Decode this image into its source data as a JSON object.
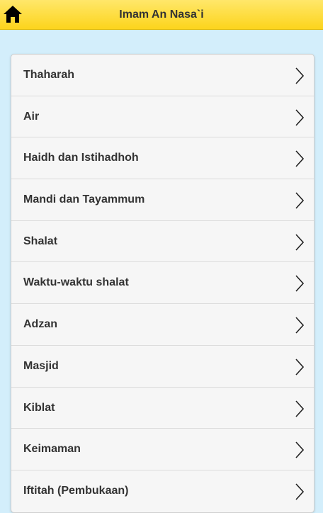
{
  "header": {
    "title": "Imam An Nasa`i",
    "home_icon": "home-icon"
  },
  "colors": {
    "header_bg": "#fcd41c",
    "page_bg": "#d3eefb",
    "list_bg": "#f6f6f6"
  },
  "list": {
    "items": [
      {
        "label": "Thaharah"
      },
      {
        "label": "Air"
      },
      {
        "label": "Haidh dan Istihadhoh"
      },
      {
        "label": "Mandi dan Tayammum"
      },
      {
        "label": "Shalat"
      },
      {
        "label": "Waktu-waktu shalat"
      },
      {
        "label": "Adzan"
      },
      {
        "label": "Masjid"
      },
      {
        "label": "Kiblat"
      },
      {
        "label": "Keimaman"
      },
      {
        "label": "Iftitah (Pembukaan)"
      }
    ],
    "chevron_icon": "chevron-right-icon"
  }
}
